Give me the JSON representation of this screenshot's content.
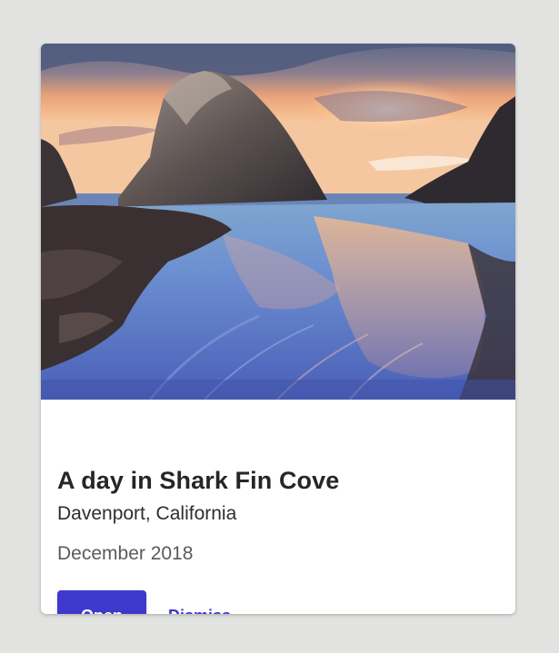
{
  "card": {
    "image_alt": "Sea stack at sunset over a wet sandy beach",
    "title": "A day in Shark Fin Cove",
    "subtitle": "Davenport, California",
    "date": "December 2018",
    "actions": {
      "primary_label": "Open",
      "secondary_label": "Dismiss"
    }
  },
  "colors": {
    "background": "#e2e3e0",
    "card": "#ffffff",
    "accent": "#3f38cc",
    "title_text": "#262626",
    "secondary_text": "#5e5a5a"
  }
}
